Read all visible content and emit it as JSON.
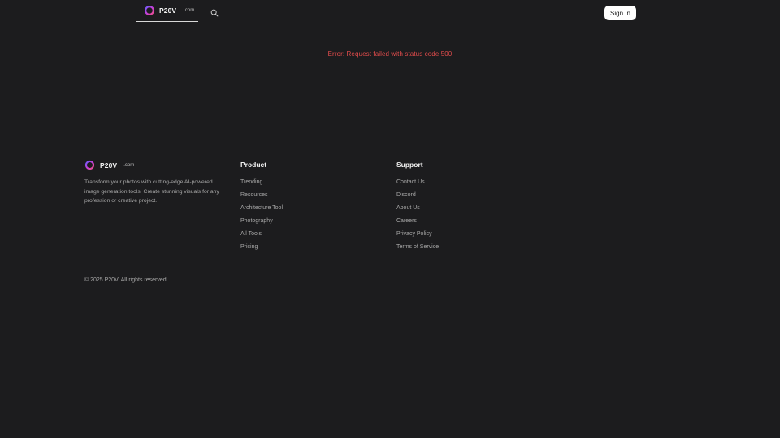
{
  "header": {
    "logo_name": "P20V",
    "logo_domain": ".com",
    "search_icon": "search-icon",
    "signin_label": "Sign In"
  },
  "main": {
    "error_text": "Error: Request failed with status code 500"
  },
  "footer": {
    "brand_name": "P20V",
    "brand_domain": ".com",
    "description": "Transform your photos with cutting-edge AI-powered image generation tools. Create stunning visuals for any profession or creative project.",
    "product": {
      "title": "Product",
      "links": [
        "Trending",
        "Resources",
        "Architecture Tool",
        "Photography",
        "All Tools",
        "Pricing"
      ]
    },
    "support": {
      "title": "Support",
      "links": [
        "Contact Us",
        "Discord",
        "About Us",
        "Careers",
        "Privacy Policy",
        "Terms of Service"
      ]
    },
    "copyright": "© 2025 P20V. All rights reserved."
  },
  "colors": {
    "background": "#1c1c1e",
    "error": "#e34c4c",
    "button_bg": "#ffffff",
    "logo_gradient": [
      "#6a5cff",
      "#c43fd8",
      "#f0508a"
    ]
  }
}
